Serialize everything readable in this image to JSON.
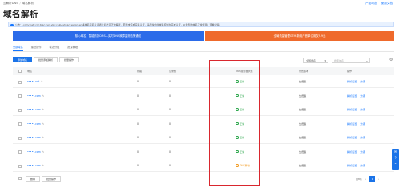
{
  "breadcrumb": {
    "root": "云解析DNS",
    "current": "域名解析"
  },
  "top_links": [
    "产品动态",
    "使用文档"
  ],
  "page_title": "域名解析",
  "notice": "公告：.com/.net/.cn/.top/.xyz/.vip/.club/.shop/.wang/.ren等域名实名认证通过后方可正常解析，若您未完成实名认证，请尽快前往域名控制台完成认证，以免影响域名正常使用。查看详情",
  "banners": {
    "left": "核心域名，智能防护DNS—实时DNS故障监测告警通知",
    "right": "全局流量管理GTM 新用户首单试用仅9.9元"
  },
  "tabs": [
    {
      "label": "全部域名",
      "active": true
    },
    {
      "label": "最近操作"
    },
    {
      "label": "域名分组"
    },
    {
      "label": "批量管理"
    }
  ],
  "toolbar": {
    "add_domain": "添加域名",
    "batch": "批量添加解析",
    "group": "批量操作"
  },
  "filter": {
    "select": "全部域名",
    "search_placeholder": "搜索域名"
  },
  "columns": {
    "domain": "域名",
    "line": "线路",
    "records": "记录数",
    "count": "请求量",
    "dns_status": "DNS服务器状态",
    "package": "付费版本",
    "ops": "操作"
  },
  "rows": [
    {
      "domain": "•••••.net",
      "line": "0",
      "records": "0",
      "dns": "正常",
      "status": "ok",
      "pkg": "免费版"
    },
    {
      "domain": "•••••.com",
      "line": "0",
      "records": "0",
      "dns": "正常",
      "status": "ok",
      "pkg": "免费版"
    },
    {
      "domain": "•••••.com",
      "line": "0",
      "records": "0",
      "dns": "正常",
      "status": "ok",
      "pkg": "免费版"
    },
    {
      "domain": "•••••.com",
      "line": "0",
      "records": "0",
      "dns": "正常",
      "status": "ok",
      "pkg": "免费版"
    },
    {
      "domain": "•••••.com",
      "line": "0",
      "records": "0",
      "dns": "正常",
      "status": "ok",
      "pkg": "免费版"
    },
    {
      "domain": "•••••.com",
      "line": "0",
      "records": "0",
      "dns": "正常",
      "status": "ok",
      "pkg": "免费版"
    },
    {
      "domain": "•••••.com",
      "line": "0",
      "records": "0",
      "dns": "DNS异常",
      "status": "warn",
      "pkg": "免费版"
    }
  ],
  "row_ops": [
    "解析设置",
    "升级"
  ],
  "footer": {
    "delete": "删除",
    "batch": "批量操作",
    "pager_label": "共8条",
    "page": "1"
  },
  "colors": {
    "accent": "#1a73e8",
    "ok": "#2aa64a",
    "warn": "#f29a1f",
    "highlight": "#d9272e"
  }
}
